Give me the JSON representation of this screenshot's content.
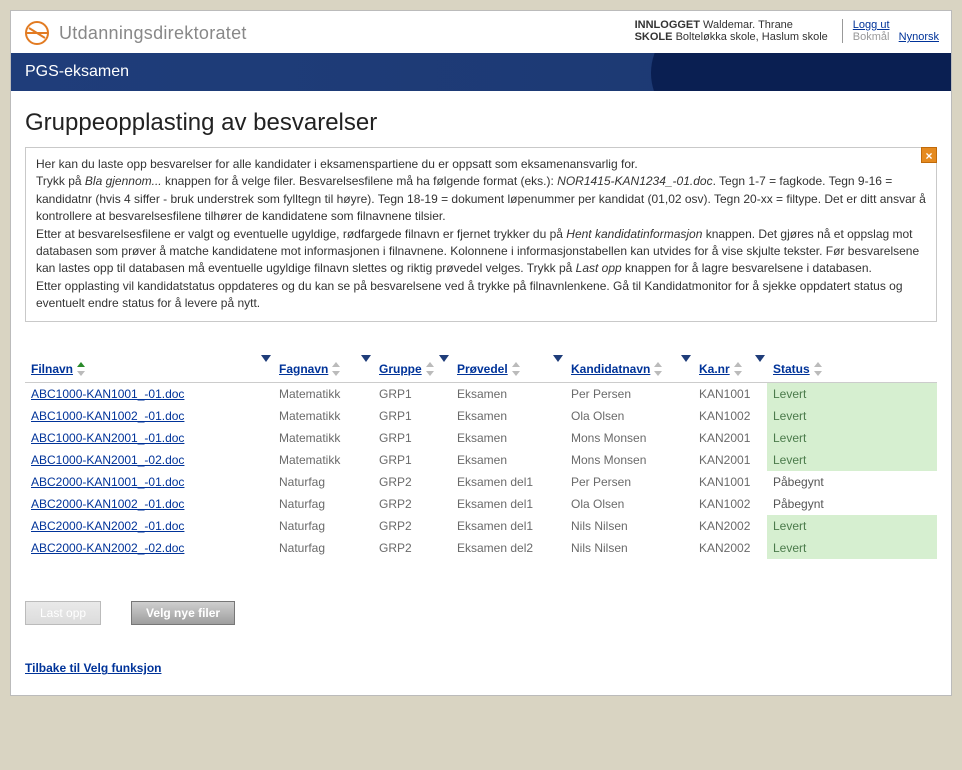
{
  "header": {
    "org_name": "Utdanningsdirektoratet",
    "logged_in_label": "INNLOGGET",
    "user_name": "Waldemar. Thrane",
    "school_label": "SKOLE",
    "school_name": "Bolteløkka skole, Haslum skole",
    "logout": "Logg ut",
    "lang_bokmal": "Bokmål",
    "lang_nynorsk": "Nynorsk"
  },
  "banner": {
    "title": "PGS-eksamen"
  },
  "page": {
    "title": "Gruppeopplasting av besvarelser"
  },
  "info": {
    "p1a": "Her kan du laste opp besvarelser for alle kandidater i eksamenspartiene du er oppsatt som eksamenansvarlig for.",
    "p1b_pre": "Trykk på ",
    "p1b_em": "Bla gjennom...",
    "p1b_mid": " knappen for å velge filer. Besvarelsesfilene må ha følgende format (eks.): ",
    "p1b_code": "NOR1415-KAN1234_-01.doc",
    "p1b_post": ". Tegn 1-7 = fagkode. Tegn 9-16 = kandidatnr (hvis 4 siffer - bruk understrek som fylltegn til høyre). Tegn 18-19 = dokument løpenummer per kandidat (01,02 osv). Tegn 20-xx = filtype. Det er ditt ansvar å kontrollere at besvarelsesfilene tilhører de kandidatene som filnavnene tilsier.",
    "p2_pre": "Etter at besvarelsesfilene er valgt og eventuelle ugyldige, rødfargede filnavn er fjernet trykker du på ",
    "p2_em": "Hent kandidatinformasjon",
    "p2_mid": " knappen. Det gjøres nå et oppslag mot databasen som prøver å matche kandidatene mot informasjonen i filnavnene. Kolonnene i informasjonstabellen kan utvides for å vise skjulte tekster. Før besvarelsene kan lastes opp til databasen må eventuelle ugyldige filnavn slettes og riktig prøvedel velges. Trykk på ",
    "p2_em2": "Last opp",
    "p2_post": " knappen for å lagre besvarelsene i databasen.",
    "p3": "Etter opplasting vil kandidatstatus oppdateres og du kan se på besvarelsene ved å trykke på filnavnlenkene. Gå til Kandidatmonitor for å sjekke oppdatert status og eventuelt endre status for å levere på nytt."
  },
  "table": {
    "headers": {
      "filnavn": "Filnavn",
      "fagnavn": "Fagnavn",
      "gruppe": "Gruppe",
      "provedel": "Prøvedel",
      "kandidatnavn": "Kandidatnavn",
      "kanr": "Ka.nr",
      "status": "Status"
    },
    "rows": [
      {
        "filnavn": "ABC1000-KAN1001_-01.doc",
        "fagnavn": "Matematikk",
        "gruppe": "GRP1",
        "provedel": "Eksamen",
        "kandidatnavn": "Per Persen",
        "kanr": "KAN1001",
        "status": "Levert",
        "status_ok": true
      },
      {
        "filnavn": "ABC1000-KAN1002_-01.doc",
        "fagnavn": "Matematikk",
        "gruppe": "GRP1",
        "provedel": "Eksamen",
        "kandidatnavn": "Ola Olsen",
        "kanr": "KAN1002",
        "status": "Levert",
        "status_ok": true
      },
      {
        "filnavn": "ABC1000-KAN2001_-01.doc",
        "fagnavn": "Matematikk",
        "gruppe": "GRP1",
        "provedel": "Eksamen",
        "kandidatnavn": "Mons Monsen",
        "kanr": "KAN2001",
        "status": "Levert",
        "status_ok": true
      },
      {
        "filnavn": "ABC1000-KAN2001_-02.doc",
        "fagnavn": "Matematikk",
        "gruppe": "GRP1",
        "provedel": "Eksamen",
        "kandidatnavn": "Mons Monsen",
        "kanr": "KAN2001",
        "status": "Levert",
        "status_ok": true
      },
      {
        "filnavn": "ABC2000-KAN1001_-01.doc",
        "fagnavn": "Naturfag",
        "gruppe": "GRP2",
        "provedel": "Eksamen del1",
        "kandidatnavn": "Per Persen",
        "kanr": "KAN1001",
        "status": "Påbegynt",
        "status_ok": false
      },
      {
        "filnavn": "ABC2000-KAN1002_-01.doc",
        "fagnavn": "Naturfag",
        "gruppe": "GRP2",
        "provedel": "Eksamen del1",
        "kandidatnavn": "Ola Olsen",
        "kanr": "KAN1002",
        "status": "Påbegynt",
        "status_ok": false
      },
      {
        "filnavn": "ABC2000-KAN2002_-01.doc",
        "fagnavn": "Naturfag",
        "gruppe": "GRP2",
        "provedel": "Eksamen del1",
        "kandidatnavn": "Nils Nilsen",
        "kanr": "KAN2002",
        "status": "Levert",
        "status_ok": true
      },
      {
        "filnavn": "ABC2000-KAN2002_-02.doc",
        "fagnavn": "Naturfag",
        "gruppe": "GRP2",
        "provedel": "Eksamen del2",
        "kandidatnavn": "Nils Nilsen",
        "kanr": "KAN2002",
        "status": "Levert",
        "status_ok": true
      }
    ]
  },
  "buttons": {
    "upload": "Last opp",
    "select_files": "Velg nye filer"
  },
  "back_link": "Tilbake til Velg funksjon"
}
